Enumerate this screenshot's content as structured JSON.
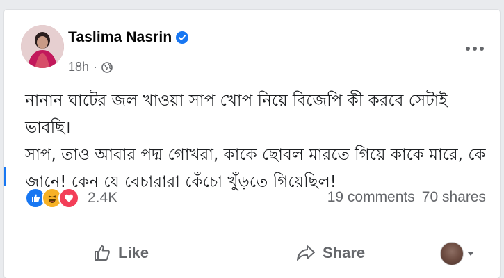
{
  "post": {
    "author": "Taslima Nasrin",
    "time": "18h",
    "separator": "·",
    "privacy_icon": "globe-icon",
    "verified_icon": "verified-badge-icon",
    "text_lines": [
      "নানান ঘাটের জল খাওয়া সাপ খোপ নিয়ে  বিজেপি কী করবে সেটাই ভাবছি।",
      "সাপ, তাও আবার পদ্ম গোখরা, কাকে ছোবল মারতে গিয়ে কাকে মারে, কে",
      "জানে!  কেন যে বেচারারা কেঁচো খুঁড়তে গিয়েছিল!"
    ],
    "reaction_count": "2.4K",
    "comments": "19 comments",
    "shares": "70 shares"
  },
  "actions": {
    "like": "Like",
    "share": "Share"
  },
  "colors": {
    "accent": "#1877f2",
    "like_blue": "#1877f2",
    "haha_yellow": "#f7b125",
    "love_red": "#f33e58",
    "muted": "#65676b"
  }
}
